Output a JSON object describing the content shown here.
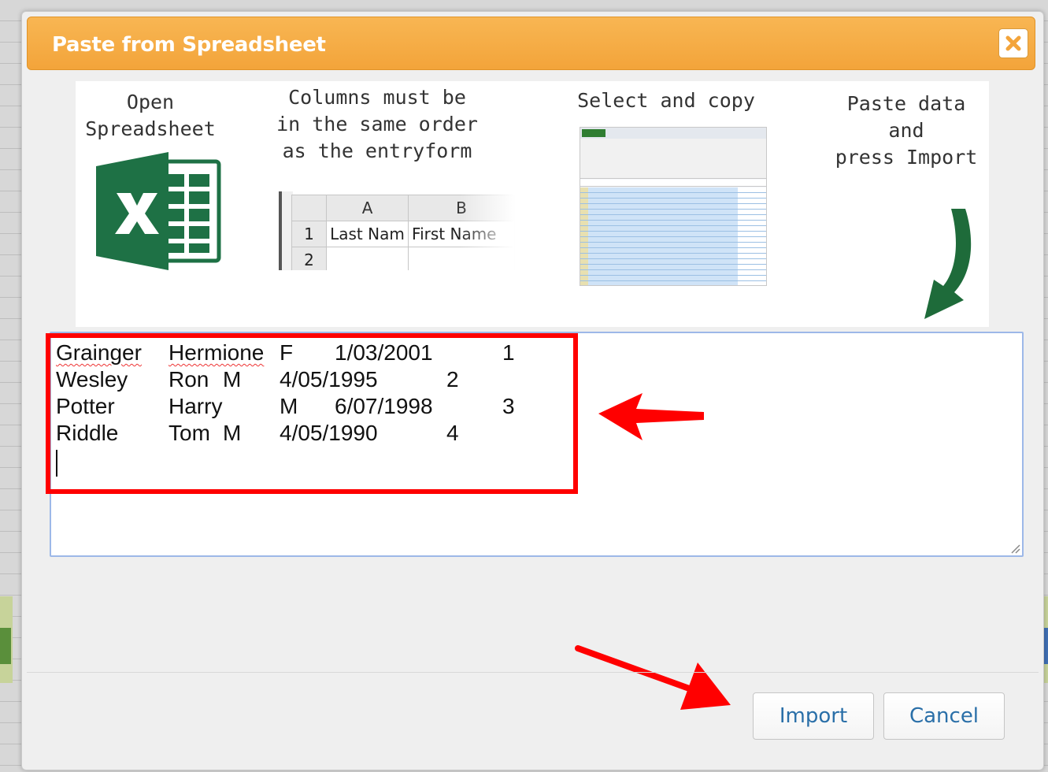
{
  "dialog": {
    "title": "Paste from Spreadsheet"
  },
  "instructions": {
    "step1": "Open\nSpreadsheet",
    "step2": "Columns must be\nin the same order\nas the entryform",
    "step3": "Select and copy",
    "step4": "Paste data\nand\npress Import",
    "sheet_preview": {
      "col_headers": [
        "A",
        "B"
      ],
      "row_numbers": [
        "1",
        "2"
      ],
      "row1": [
        "Last Nam",
        "First Name"
      ]
    }
  },
  "paste_area": {
    "rows": [
      [
        "Grainger",
        "Hermione",
        "F",
        "1/03/2001",
        "1"
      ],
      [
        "Wesley",
        "Ron",
        "M",
        "4/05/1995",
        "2"
      ],
      [
        "Potter",
        "Harry",
        "M",
        "6/07/1998",
        "3"
      ],
      [
        "Riddle",
        "Tom",
        "M",
        "4/05/1990",
        "4"
      ]
    ]
  },
  "buttons": {
    "import": "Import",
    "cancel": "Cancel"
  },
  "icons": {
    "close": "close-icon",
    "excel": "excel-logo-icon",
    "green_arrow": "curved-arrow-down-icon"
  },
  "colors": {
    "titlebar": "#f3a43a",
    "title_text": "#ffffff",
    "button_text": "#2a6fa8",
    "highlight": "#ff0000",
    "excel_green": "#1e7145"
  }
}
